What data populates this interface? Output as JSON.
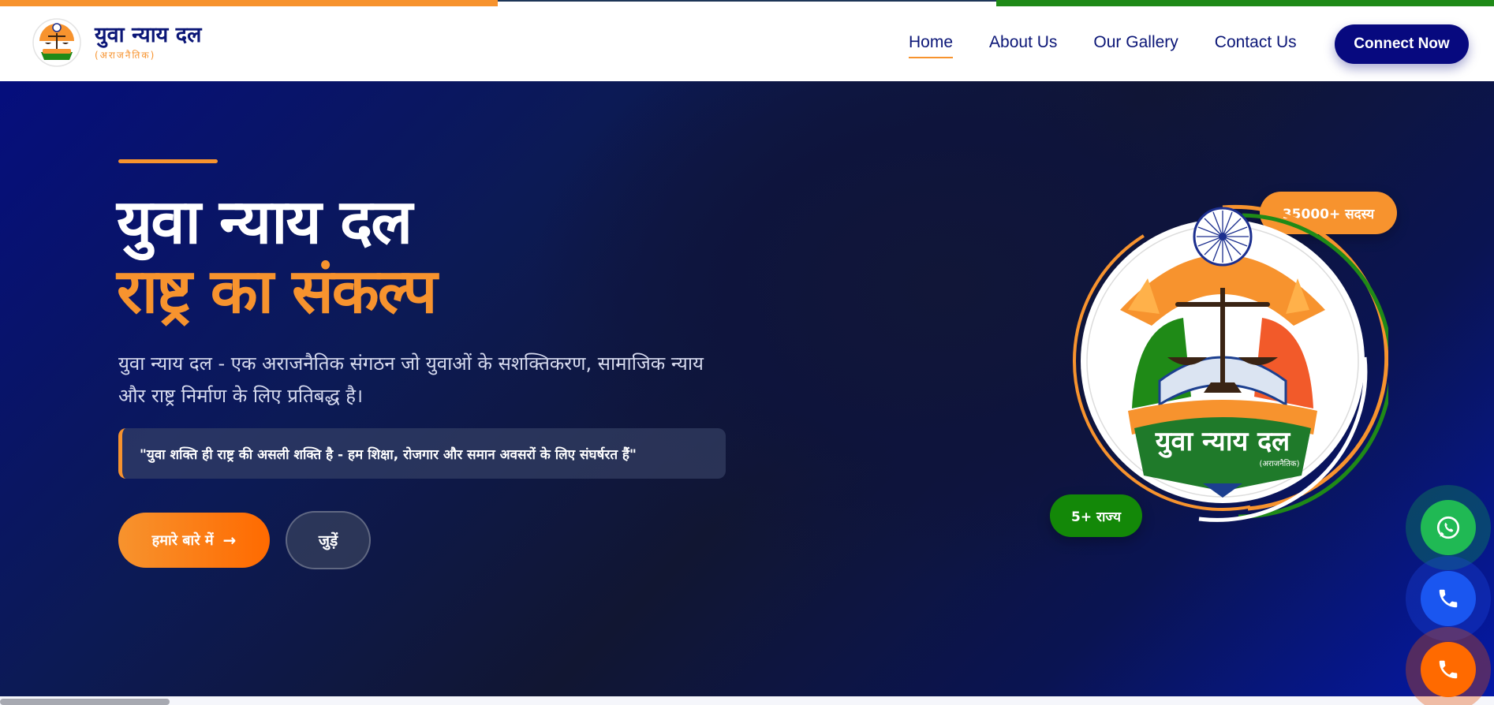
{
  "header": {
    "brand_name": "युवा न्याय दल",
    "brand_sub": "(अराजनैतिक)",
    "nav": [
      {
        "label": "Home"
      },
      {
        "label": "About Us"
      },
      {
        "label": "Our Gallery"
      },
      {
        "label": "Contact Us"
      }
    ],
    "cta_label": "Connect Now"
  },
  "hero": {
    "title_line1": "युवा न्याय दल",
    "title_line2": "राष्ट्र का संकल्प",
    "description": "युवा न्याय दल - एक अराजनैतिक संगठन जो युवाओं के सशक्तिकरण, सामाजिक न्याय और राष्ट्र निर्माण के लिए प्रतिबद्ध है।",
    "quote": "\"युवा शक्ति ही राष्ट्र की असली शक्ति है - हम शिक्षा, रोजगार और समान अवसरों के लिए संघर्षरत हैं\"",
    "btn_about": "हमारे बारे में",
    "btn_join": "जुड़ें",
    "badge_members": "35000+ सदस्य",
    "badge_states": "5+ राज्य",
    "emblem_title": "युवा न्याय दल",
    "emblem_sub": "(अराजनैतिक)"
  },
  "colors": {
    "saffron": "#f7932e",
    "green": "#138808",
    "navy": "#0b1677",
    "whatsapp": "#20b954",
    "call_blue": "#1a56f0",
    "call_orange": "#ff6a00"
  },
  "icons": {
    "whatsapp": "whatsapp-icon",
    "phone": "phone-icon",
    "arrow": "arrow-right-icon"
  }
}
